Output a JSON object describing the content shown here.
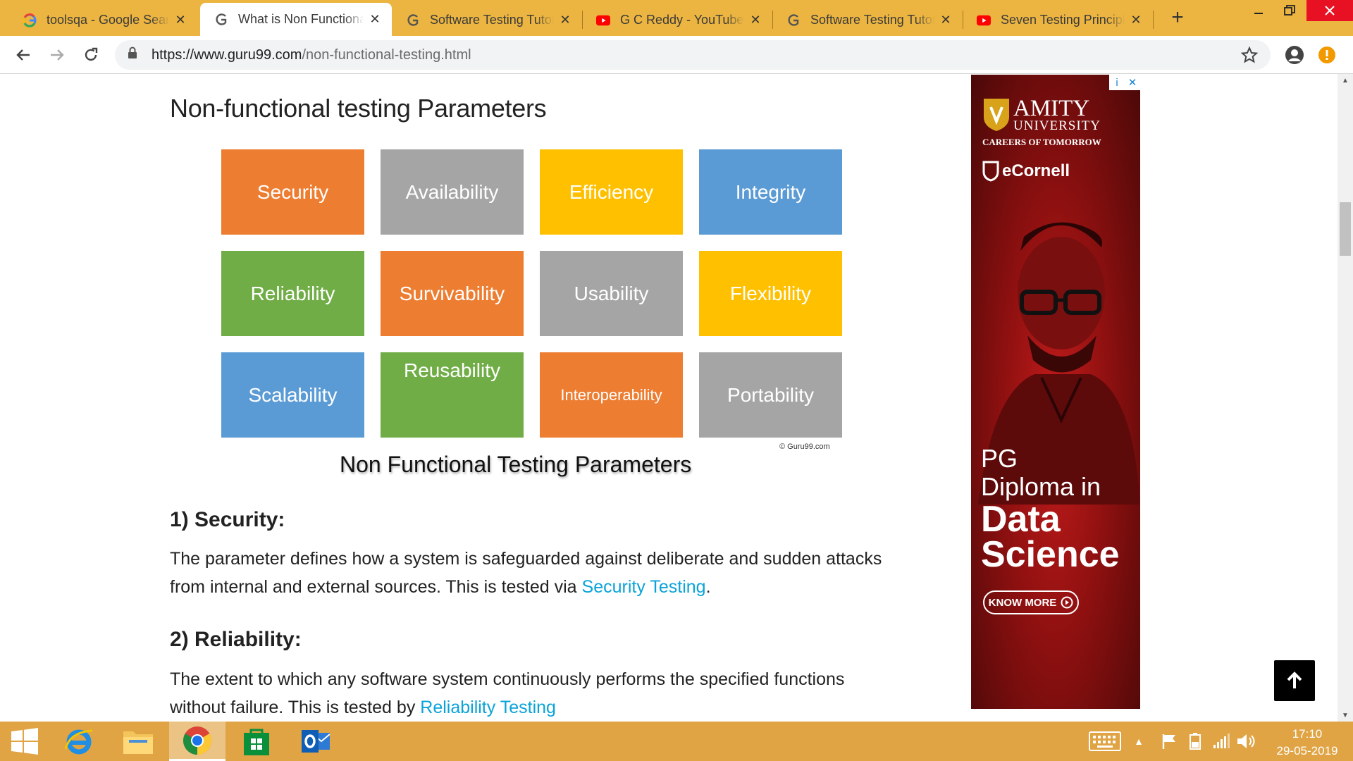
{
  "browser": {
    "tabs": [
      {
        "title": "toolsqa - Google Search",
        "favicon": "google-icon"
      },
      {
        "title": "What is Non Functional Testing",
        "favicon": "guru99-icon",
        "active": true
      },
      {
        "title": "Software Testing Tutorial",
        "favicon": "guru99-icon"
      },
      {
        "title": "G C Reddy - YouTube",
        "favicon": "youtube-icon"
      },
      {
        "title": "Software Testing Tutorial",
        "favicon": "guru99-icon"
      },
      {
        "title": "Seven Testing Principles",
        "favicon": "youtube-icon"
      }
    ],
    "url_host": "https://www.guru99.com",
    "url_path": "/non-functional-testing.html"
  },
  "article": {
    "heading": "Non-functional testing Parameters",
    "params": [
      "Security",
      "Availability",
      "Efficiency",
      "Integrity",
      "Reliability",
      "Survivability",
      "Usability",
      "Flexibility",
      "Scalability",
      "Reusability",
      "Interoperability",
      "Portability"
    ],
    "credit": "© Guru99.com",
    "caption": "Non Functional Testing Parameters",
    "s1_heading": "1) Security:",
    "s1_text": "The parameter defines how a system is safeguarded against deliberate and sudden attacks from internal and external sources. This is tested via ",
    "s1_link": "Security Testing",
    "s1_end": ".",
    "s2_heading": "2) Reliability:",
    "s2_text": "The extent to which any software system continuously performs the specified functions without failure. This is tested by ",
    "s2_link": "Reliability Testing"
  },
  "ad": {
    "brand": "AMITY",
    "brand_sub": "UNIVERSITY",
    "tagline": "CAREERS OF TOMORROW",
    "partner": "eCornell",
    "line1": "PG",
    "line2": "Diploma in",
    "line3": "Data",
    "line4": "Science",
    "cta": "KNOW MORE",
    "info": "i",
    "close": "✕"
  },
  "taskbar": {
    "time": "17:10",
    "date": "29-05-2019"
  },
  "colors": {
    "tabstrip": "#ecb541",
    "taskbar": "#e0a444",
    "link": "#0aa3d8"
  }
}
